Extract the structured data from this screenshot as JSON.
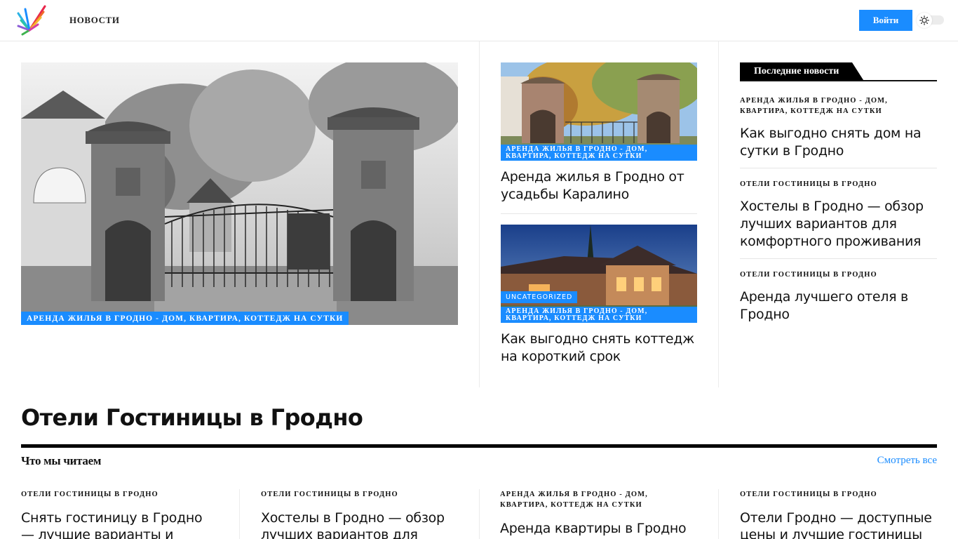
{
  "header": {
    "nav_news": "НОВОСТИ",
    "login": "Войти"
  },
  "featured": {
    "category": "АРЕНДА ЖИЛЬЯ В ГРОДНО - ДОМ, КВАРТИРА, КОТТЕДЖ НА СУТКИ"
  },
  "middle": [
    {
      "category": "АРЕНДА ЖИЛЬЯ В ГРОДНО - ДОМ, КВАРТИРА, КОТТЕДЖ НА СУТКИ",
      "title": "Аренда жилья в Гродно от усадьбы Каралино"
    },
    {
      "extra_tag": "UNCATEGORIZED",
      "category": "АРЕНДА ЖИЛЬЯ В ГРОДНО - ДОМ, КВАРТИРА, КОТТЕДЖ НА СУТКИ",
      "title": "Как выгодно снять коттедж на короткий срок"
    }
  ],
  "sidebar": {
    "heading": "Последние новости",
    "items": [
      {
        "kicker": "АРЕНДА ЖИЛЬЯ В ГРОДНО - ДОМ, КВАРТИРА, КОТТЕДЖ НА СУТКИ",
        "title": "Как выгодно снять дом на сутки в Гродно"
      },
      {
        "kicker": "ОТЕЛИ ГОСТИНИЦЫ В ГРОДНО",
        "title": "Хостелы в Гродно — обзор лучших вариантов для комфортного проживания"
      },
      {
        "kicker": "ОТЕЛИ ГОСТИНИЦЫ В ГРОДНО",
        "title": "Аренда лучшего отеля в Гродно"
      }
    ]
  },
  "section": {
    "title": "Отели Гостиницы в Гродно",
    "reading": "Что мы читаем",
    "see_all": "Смотреть все",
    "items": [
      {
        "kicker": "ОТЕЛИ ГОСТИНИЦЫ В ГРОДНО",
        "title": "Снять гостиницу в Гродно — лучшие варианты и советы"
      },
      {
        "kicker": "ОТЕЛИ ГОСТИНИЦЫ В ГРОДНО",
        "title": "Хостелы в Гродно — обзор лучших вариантов для"
      },
      {
        "kicker": "АРЕНДА ЖИЛЬЯ В ГРОДНО - ДОМ, КВАРТИРА, КОТТЕДЖ НА СУТКИ",
        "title": "Аренда квартиры в Гродно на"
      },
      {
        "kicker": "ОТЕЛИ ГОСТИНИЦЫ В ГРОДНО",
        "title": "Отели Гродно — доступные цены и лучшие гостиницы для"
      }
    ]
  },
  "colors": {
    "accent": "#1a8cff",
    "text": "#111111",
    "divider": "#ececec"
  }
}
